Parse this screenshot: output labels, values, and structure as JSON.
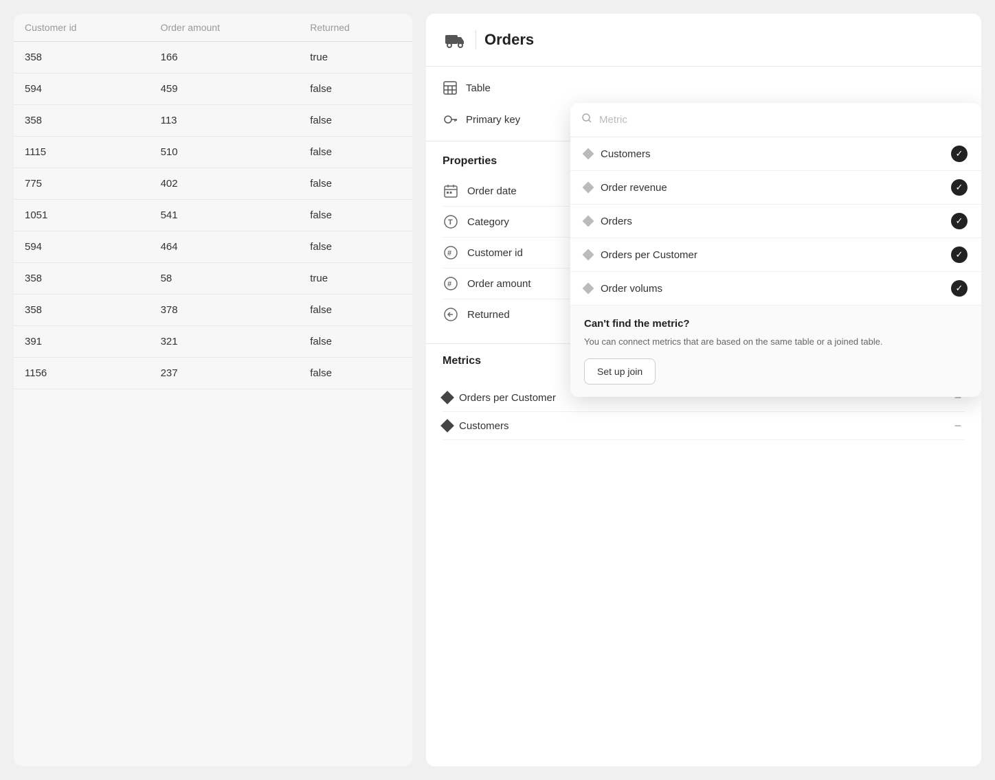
{
  "leftPanel": {
    "columns": [
      "Customer id",
      "Order amount",
      "Returned"
    ],
    "rows": [
      {
        "customer_id": "358",
        "order_amount": "166",
        "returned": "true"
      },
      {
        "customer_id": "594",
        "order_amount": "459",
        "returned": "false"
      },
      {
        "customer_id": "358",
        "order_amount": "113",
        "returned": "false"
      },
      {
        "customer_id": "1115",
        "order_amount": "510",
        "returned": "false"
      },
      {
        "customer_id": "775",
        "order_amount": "402",
        "returned": "false"
      },
      {
        "customer_id": "1051",
        "order_amount": "541",
        "returned": "false"
      },
      {
        "customer_id": "594",
        "order_amount": "464",
        "returned": "false"
      },
      {
        "customer_id": "358",
        "order_amount": "58",
        "returned": "true"
      },
      {
        "customer_id": "358",
        "order_amount": "378",
        "returned": "false"
      },
      {
        "customer_id": "391",
        "order_amount": "321",
        "returned": "false"
      },
      {
        "customer_id": "1156",
        "order_amount": "237",
        "returned": "false"
      }
    ]
  },
  "rightPanel": {
    "header": {
      "title": "Orders",
      "icon": "truck"
    },
    "navItems": [
      {
        "label": "Table",
        "icon": "table"
      },
      {
        "label": "Primary key",
        "icon": "key"
      }
    ],
    "propertiesSection": {
      "title": "Properties",
      "items": [
        {
          "label": "Order date",
          "icon": "calendar"
        },
        {
          "label": "Category",
          "icon": "text"
        },
        {
          "label": "Customer id",
          "icon": "hash"
        },
        {
          "label": "Order amount",
          "icon": "hash"
        },
        {
          "label": "Returned",
          "icon": "arrow-left"
        }
      ]
    },
    "metricsSection": {
      "title": "Metrics",
      "items": [
        {
          "label": "Orders per Customer"
        },
        {
          "label": "Customers"
        }
      ]
    }
  },
  "dropdown": {
    "searchPlaceholder": "Metric",
    "options": [
      {
        "label": "Customers",
        "checked": true
      },
      {
        "label": "Order revenue",
        "checked": true
      },
      {
        "label": "Orders",
        "checked": true
      },
      {
        "label": "Orders per Customer",
        "checked": true
      },
      {
        "label": "Order volums",
        "checked": true
      }
    ],
    "cantFind": {
      "title": "Can't find the metric?",
      "description": "You can connect metrics that are based on the same table or a joined table.",
      "buttonLabel": "Set up join"
    }
  }
}
